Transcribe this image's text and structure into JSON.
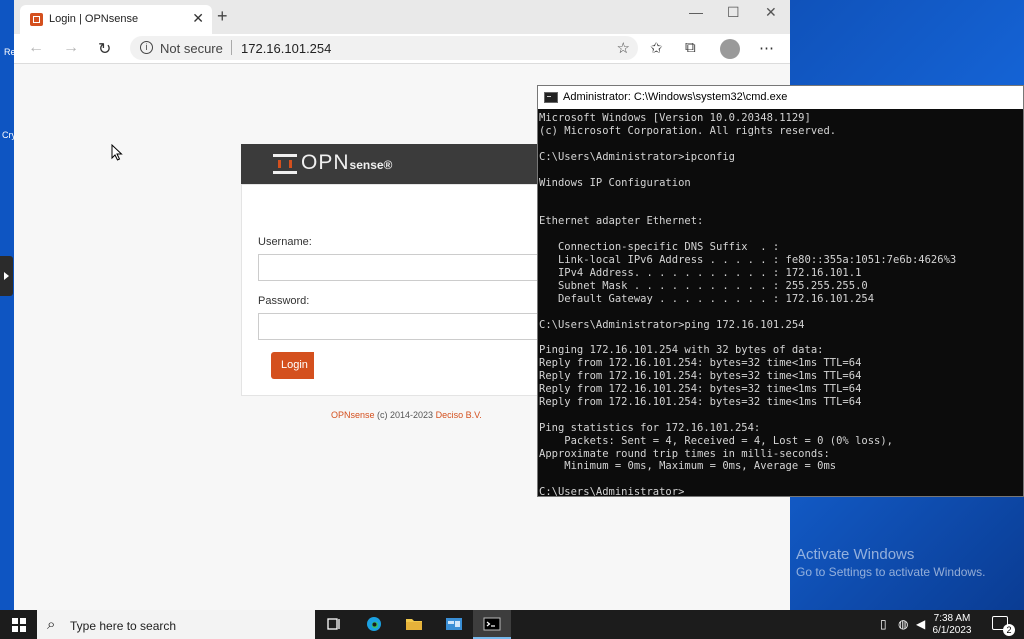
{
  "desktop": {
    "icon_labels": [
      "Re",
      "Cry"
    ],
    "watermark": {
      "title": "Activate Windows",
      "subtitle": "Go to Settings to activate Windows."
    }
  },
  "browser": {
    "tab_title": "Login | OPNsense",
    "tab_close": "✕",
    "new_tab": "+",
    "window_controls": {
      "minimize": "—",
      "maximize": "☐",
      "close": "✕"
    },
    "address": {
      "security_label": "Not secure",
      "url": "172.16.101.254"
    },
    "icons": [
      "back-arrow-icon",
      "forward-arrow-icon",
      "refresh-icon",
      "info-icon",
      "star-icon",
      "favorites-icon",
      "collections-icon",
      "profile-icon",
      "more-icon"
    ]
  },
  "login": {
    "logo_text": "OPN",
    "logo_suffix": "sense",
    "logo_reg": "®",
    "username_label": "Username:",
    "password_label": "Password:",
    "username_value": "",
    "password_value": "",
    "login_button": "Login",
    "footer": {
      "brand": "OPNsense",
      "copyright": " (c) 2014-2023 ",
      "company": "Deciso B.V."
    }
  },
  "cmd": {
    "title": "Administrator: C:\\Windows\\system32\\cmd.exe",
    "lines": [
      "Microsoft Windows [Version 10.0.20348.1129]",
      "(c) Microsoft Corporation. All rights reserved.",
      "",
      "C:\\Users\\Administrator>ipconfig",
      "",
      "Windows IP Configuration",
      "",
      "",
      "Ethernet adapter Ethernet:",
      "",
      "   Connection-specific DNS Suffix  . :",
      "   Link-local IPv6 Address . . . . . : fe80::355a:1051:7e6b:4626%3",
      "   IPv4 Address. . . . . . . . . . . : 172.16.101.1",
      "   Subnet Mask . . . . . . . . . . . : 255.255.255.0",
      "   Default Gateway . . . . . . . . . : 172.16.101.254",
      "",
      "C:\\Users\\Administrator>ping 172.16.101.254",
      "",
      "Pinging 172.16.101.254 with 32 bytes of data:",
      "Reply from 172.16.101.254: bytes=32 time<1ms TTL=64",
      "Reply from 172.16.101.254: bytes=32 time<1ms TTL=64",
      "Reply from 172.16.101.254: bytes=32 time<1ms TTL=64",
      "Reply from 172.16.101.254: bytes=32 time<1ms TTL=64",
      "",
      "Ping statistics for 172.16.101.254:",
      "    Packets: Sent = 4, Received = 4, Lost = 0 (0% loss),",
      "Approximate round trip times in milli-seconds:",
      "    Minimum = 0ms, Maximum = 0ms, Average = 0ms",
      "",
      "C:\\Users\\Administrator>"
    ]
  },
  "taskbar": {
    "search_placeholder": "Type here to search",
    "time": "7:38 AM",
    "date": "6/1/2023",
    "notification_count": "2",
    "apps": [
      "task-view-icon",
      "edge-icon",
      "file-explorer-icon",
      "server-manager-icon",
      "cmd-icon"
    ],
    "colors": {
      "accent": "#76b9ed",
      "opnsense": "#d4501e"
    }
  }
}
